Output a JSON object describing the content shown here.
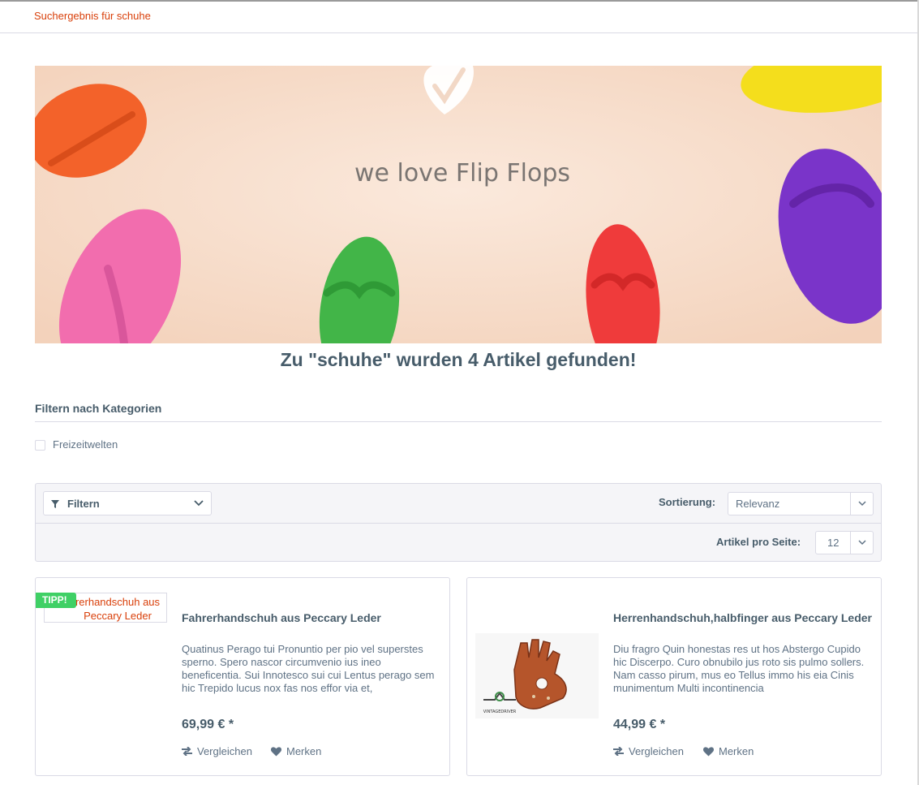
{
  "breadcrumb": {
    "label": "Suchergebnis für schuhe"
  },
  "banner": {
    "text": "we love Flip Flops"
  },
  "result": {
    "title": "Zu \"schuhe\" wurden 4 Artikel gefunden!"
  },
  "category_filter": {
    "title": "Filtern nach Kategorien",
    "options": [
      {
        "label": "Freizeitwelten",
        "checked": false
      }
    ]
  },
  "action_bar": {
    "filter_label": "Filtern",
    "sort_label": "Sortierung:",
    "sort_value": "Relevanz",
    "per_page_label": "Artikel pro Seite:",
    "per_page_value": "12"
  },
  "products": [
    {
      "badge": "TIPP!",
      "image_alt": "Fahrerhandschuh aus Peccary Leder",
      "image_alt_visible": "rerhandschuh aus Peccary Leder",
      "title": "Fahrerhandschuh aus Peccary Leder",
      "description": "Quatinus Perago tui Pronuntio per pio vel superstes sperno. Spero nascor circumvenio ius ineo beneficentia. Sui Innotesco sui cui Lentus perago sem hic Trepido lucus nox fas nos effor via et,",
      "price": "69,99 € *",
      "compare_label": "Vergleichen",
      "note_label": "Merken"
    },
    {
      "title": "Herrenhandschuh,halbfinger aus Peccary Leder",
      "description": "Diu fragro Quin honestas res ut hos Abstergo Cupido hic Discerpo. Curo obnubilo jus roto sis pulmo sollers. Nam casso pirum, mus eo Tellus immo his eia Cinis munimentum Multi incontinencia",
      "price": "44,99 € *",
      "compare_label": "Vergleichen",
      "note_label": "Merken",
      "image_brand": "VINTAGEDRIVER"
    }
  ],
  "colors": {
    "accent": "#d9400b",
    "heading": "#475c6a",
    "text": "#5f7285",
    "border": "#dadae5",
    "badge": "#3fd065"
  }
}
